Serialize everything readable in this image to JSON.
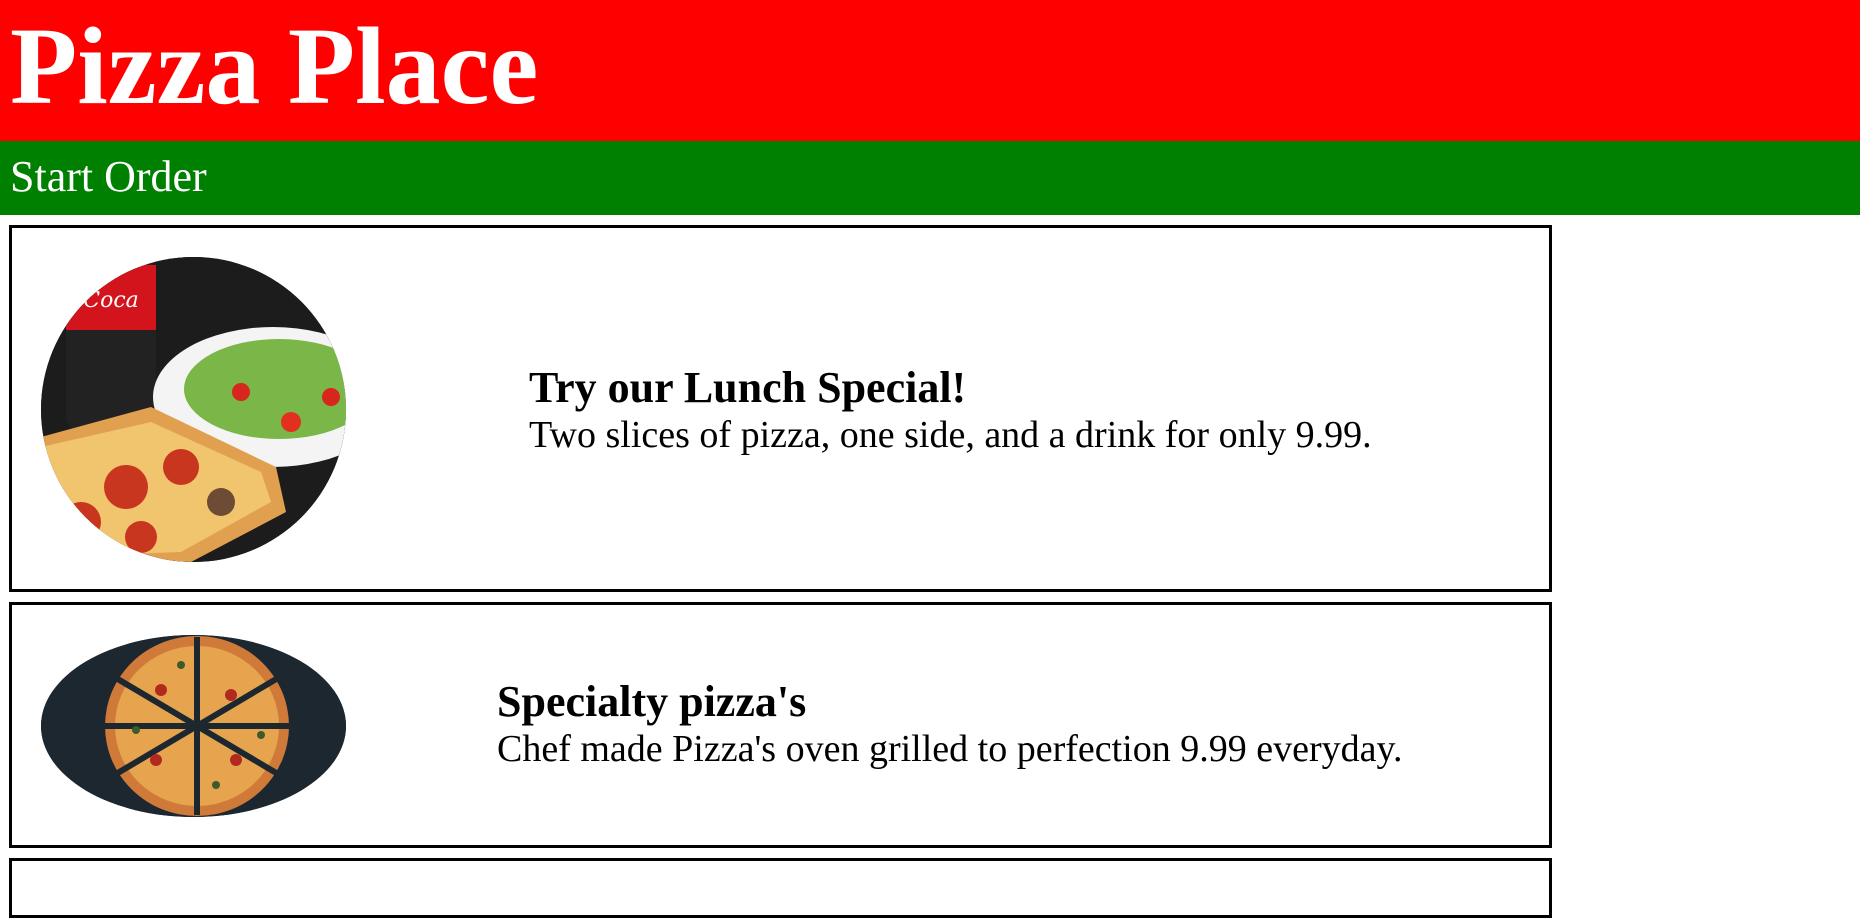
{
  "header": {
    "title": "Pizza Place",
    "background": "#ff0000"
  },
  "nav": {
    "start_order_label": "Start Order",
    "background": "#008000"
  },
  "specials": [
    {
      "heading": "Try our Lunch Special!",
      "description": "Two slices of pizza, one side, and a drink for only 9.99.",
      "image": "lunch-special-photo"
    },
    {
      "heading": "Specialty pizza's",
      "description": "Chef made Pizza's oven grilled to perfection 9.99 everyday.",
      "image": "specialty-pizza-photo"
    }
  ]
}
